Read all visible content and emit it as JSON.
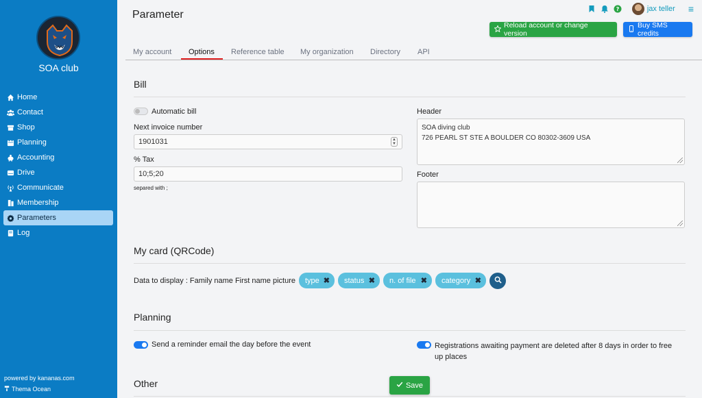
{
  "sidebar": {
    "club_name": "SOA club",
    "items": [
      {
        "label": "Home",
        "icon": "home-icon"
      },
      {
        "label": "Contact",
        "icon": "users-icon"
      },
      {
        "label": "Shop",
        "icon": "shop-icon"
      },
      {
        "label": "Planning",
        "icon": "calendar-icon"
      },
      {
        "label": "Accounting",
        "icon": "piggy-bank-icon"
      },
      {
        "label": "Drive",
        "icon": "drive-icon"
      },
      {
        "label": "Communicate",
        "icon": "broadcast-icon"
      },
      {
        "label": "Membership",
        "icon": "id-card-icon"
      },
      {
        "label": "Parameters",
        "icon": "gear-icon"
      },
      {
        "label": "Log",
        "icon": "book-icon"
      }
    ],
    "active_item": "Parameters",
    "powered_by": "powered by kananas.com",
    "theme": "Thema Ocean"
  },
  "header": {
    "title": "Parameter",
    "user_name": "jax teller",
    "reload_button": "Reload account or change version",
    "sms_button": "Buy SMS credits"
  },
  "tabs": [
    {
      "label": "My account"
    },
    {
      "label": "Options"
    },
    {
      "label": "Reference table"
    },
    {
      "label": "My organization"
    },
    {
      "label": "Directory"
    },
    {
      "label": "API"
    }
  ],
  "active_tab": "Options",
  "bill": {
    "title": "Bill",
    "automatic_bill_label": "Automatic bill",
    "automatic_bill_on": false,
    "next_invoice_label": "Next invoice number",
    "next_invoice_value": "1901031",
    "tax_label": "% Tax",
    "tax_value": "10;5;20",
    "tax_hint": "separed with ;",
    "header_label": "Header",
    "header_line1": "SOA diving club",
    "header_line2": "726 PEARL ST STE A BOULDER CO 80302-3609 USA",
    "footer_label": "Footer",
    "footer_value": ""
  },
  "card": {
    "title": "My card (QRCode)",
    "display_label": "Data to display : Family name First name picture",
    "chips": [
      "type",
      "status",
      "n. of file",
      "category"
    ]
  },
  "planning": {
    "title": "Planning",
    "reminder_label": "Send a reminder email the day before the event",
    "reminder_on": true,
    "registrations_line1": "Registrations awaiting payment are deleted after 8 days in order to free",
    "registrations_line2": "up places",
    "registrations_on": true
  },
  "other": {
    "title": "Other"
  },
  "save_button": "Save",
  "colors": {
    "sidebar": "#0b7cc4",
    "active_nav": "#a9d5f6",
    "green": "#2aa444",
    "blue": "#1979f0",
    "chip": "#5bc0de",
    "tab_underline": "#e02020"
  }
}
